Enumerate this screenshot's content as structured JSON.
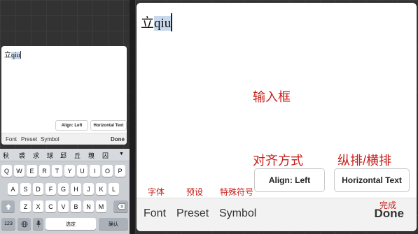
{
  "preview": {
    "text_head": "立",
    "text_selected": "qiu",
    "align_button": "Align: Left",
    "orientation_button": "Horizontal Text",
    "toolbar": {
      "font": "Font",
      "preset": "Preset",
      "symbol": "Symbol",
      "done": "Done"
    }
  },
  "candidates": [
    "秋",
    "裘",
    "求",
    "球",
    "邱",
    "丘",
    "糗",
    "囚"
  ],
  "keyboard": {
    "row1": [
      "Q",
      "W",
      "E",
      "R",
      "T",
      "Y",
      "U",
      "I",
      "O",
      "P"
    ],
    "row2": [
      "A",
      "S",
      "D",
      "F",
      "G",
      "H",
      "J",
      "K",
      "L"
    ],
    "row3": [
      "Z",
      "X",
      "C",
      "V",
      "B",
      "N",
      "M"
    ],
    "shift_icon": "shift-arrow-icon",
    "delete_icon": "backspace-icon",
    "num_key": "123",
    "globe_icon": "globe-icon",
    "mic_icon": "microphone-icon",
    "space_key": "选定",
    "confirm_key": "确认"
  },
  "main": {
    "text_head": "立",
    "text_selected": "qiu",
    "annotations": {
      "input_box": "输入框",
      "alignment": "对齐方式",
      "orientation": "纵排/横排",
      "font": "字体",
      "preset": "预设",
      "symbol": "特殊符号",
      "done": "完成"
    },
    "align_button": "Align: Left",
    "orientation_button": "Horizontal Text",
    "toolbar": {
      "font": "Font",
      "preset": "Preset",
      "symbol": "Symbol",
      "done": "Done"
    }
  },
  "colors": {
    "annotation": "#c8211c",
    "selection": "#c9d9ec"
  }
}
